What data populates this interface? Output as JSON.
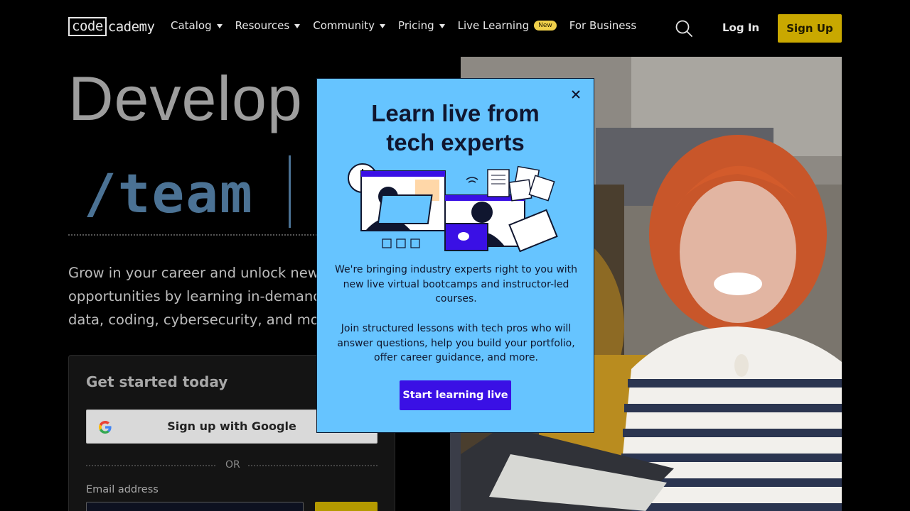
{
  "nav": {
    "logo_code": "code",
    "logo_rest": "cademy",
    "items": [
      {
        "label": "Catalog",
        "has_caret": true
      },
      {
        "label": "Resources",
        "has_caret": true
      },
      {
        "label": "Community",
        "has_caret": true
      },
      {
        "label": "Pricing",
        "has_caret": true
      },
      {
        "label": "Live Learning",
        "badge": "New"
      },
      {
        "label": "For Business"
      }
    ],
    "search_icon": "search-icon",
    "login_label": "Log In",
    "signup_label": "Sign Up",
    "signup_color": "#c9a800"
  },
  "hero": {
    "title": "Develop",
    "typed_text": "/team",
    "description_lines": [
      "Grow in your career and unlock new",
      "opportunities by learning in-demand",
      "data, coding, cybersecurity, and more"
    ]
  },
  "signup_card": {
    "title": "Get started today",
    "google_label": "Sign up with Google",
    "or_text": "OR",
    "email_label": "Email address"
  },
  "modal": {
    "title_line1": "Learn live from",
    "title_line2": "tech experts",
    "paragraph1": "We're bringing industry experts right to you with new live virtual bootcamps and instructor-led courses.",
    "paragraph2": "Join structured lessons with tech pros who will answer questions, help you build your portfolio, offer career guidance, and more.",
    "cta_label": "Start learning live",
    "background": "#66c4ff",
    "cta_color": "#3a10e5",
    "close_icon": "close-icon"
  }
}
